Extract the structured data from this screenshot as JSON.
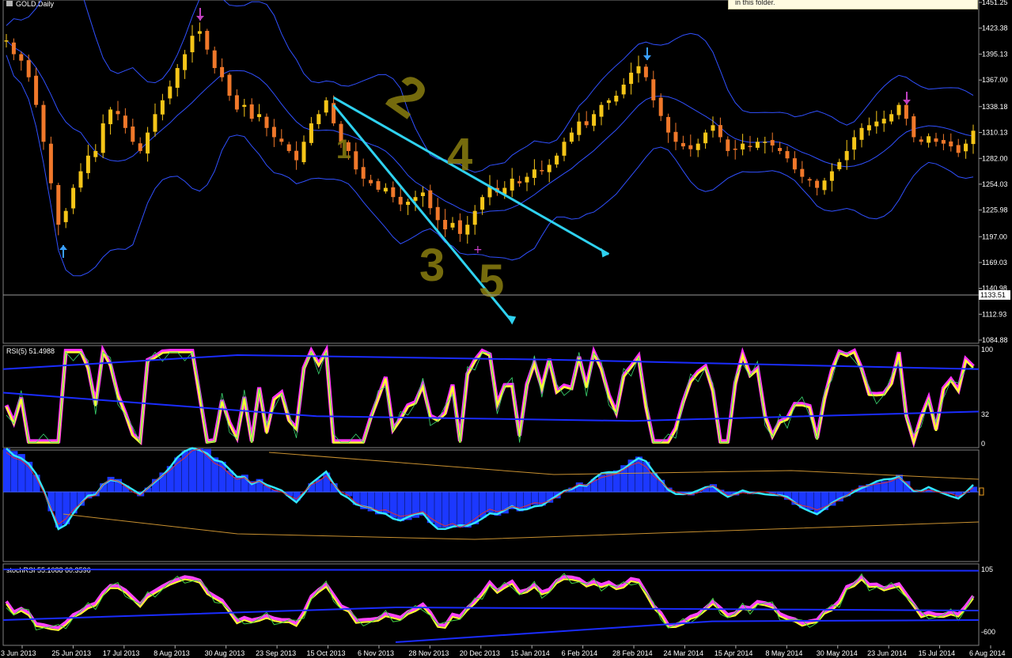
{
  "chart_data": [
    {
      "type": "candlestick",
      "title": "GOLD,Daily",
      "symbol": "GOLD",
      "timeframe": "Daily",
      "y_ticks": [
        "1451.25",
        "1423.38",
        "1395.13",
        "1367.00",
        "1338.18",
        "1310.13",
        "1282.00",
        "1254.03",
        "1225.98",
        "1197.00",
        "1169.03",
        "1140.98",
        "1112.93",
        "1084.88"
      ],
      "current_price_label": "1133.51",
      "x_ticks": [
        "3 Jun 2013",
        "25 Jun 2013",
        "17 Jul 2013",
        "8 Aug 2013",
        "30 Aug 2013",
        "23 Sep 2013",
        "15 Oct 2013",
        "6 Nov 2013",
        "28 Nov 2013",
        "20 Dec 2013",
        "15 Jan 2014",
        "6 Feb 2014",
        "28 Feb 2014",
        "24 Mar 2014",
        "15 Apr 2014",
        "8 May 2014",
        "30 May 2014",
        "23 Jun 2014",
        "15 Jul 2014",
        "6 Aug 2014"
      ],
      "close_series": [
        1410,
        1395,
        1388,
        1370,
        1340,
        1300,
        1255,
        1210,
        1225,
        1250,
        1268,
        1285,
        1290,
        1320,
        1335,
        1330,
        1315,
        1300,
        1290,
        1310,
        1330,
        1345,
        1360,
        1380,
        1395,
        1415,
        1420,
        1400,
        1380,
        1370,
        1350,
        1335,
        1340,
        1325,
        1330,
        1315,
        1305,
        1300,
        1290,
        1280,
        1300,
        1320,
        1330,
        1345,
        1320,
        1300,
        1290,
        1270,
        1260,
        1255,
        1248,
        1250,
        1240,
        1232,
        1235,
        1240,
        1245,
        1228,
        1215,
        1205,
        1212,
        1200,
        1210,
        1225,
        1240,
        1252,
        1245,
        1250,
        1260,
        1255,
        1262,
        1270,
        1268,
        1275,
        1285,
        1300,
        1310,
        1322,
        1318,
        1330,
        1340,
        1345,
        1350,
        1362,
        1375,
        1382,
        1370,
        1345,
        1328,
        1310,
        1300,
        1295,
        1292,
        1298,
        1310,
        1318,
        1305,
        1290,
        1292,
        1298,
        1295,
        1300,
        1300,
        1296,
        1290,
        1282,
        1270,
        1262,
        1258,
        1250,
        1258,
        1268,
        1278,
        1290,
        1305,
        1315,
        1318,
        1322,
        1325,
        1330,
        1340,
        1325,
        1305,
        1300,
        1306,
        1300,
        1298,
        1295,
        1288,
        1298,
        1312
      ],
      "rsi_label": "RSI(5) 51.4988",
      "rsi_levels": [
        "100",
        "32",
        "0"
      ],
      "stoch_rsi_label": "stochRSI 55.1088 60.3596",
      "stoch_levels": [
        "105",
        "-600"
      ],
      "annotations": {
        "wave_labels": [
          "1",
          "2",
          "3",
          "4",
          "5"
        ],
        "trendlines": 2,
        "markers": [
          "up-arrow (low Jun 2013)",
          "down-arrow (high Aug 2013)",
          "down-arrow (high Mar 2014)",
          "down-arrow (high Jul 2014)",
          "cross (low Dec 2013)"
        ]
      },
      "colors": {
        "candle_up": "#f5c518",
        "candle_down": "#f0782a",
        "bollinger": "#3050ff",
        "trendline": "#2fd2f0",
        "wave_label": "#8a7e10",
        "rsi_main": "#ffff33",
        "rsi_shadow": "#ff33ff",
        "macd_hist": "#1c38ff",
        "macd_line": "#32e6ff",
        "stoch_k": "#ff44ff",
        "stoch_d": "#ffff33"
      }
    }
  ],
  "notice": {
    "text": "in this folder."
  }
}
